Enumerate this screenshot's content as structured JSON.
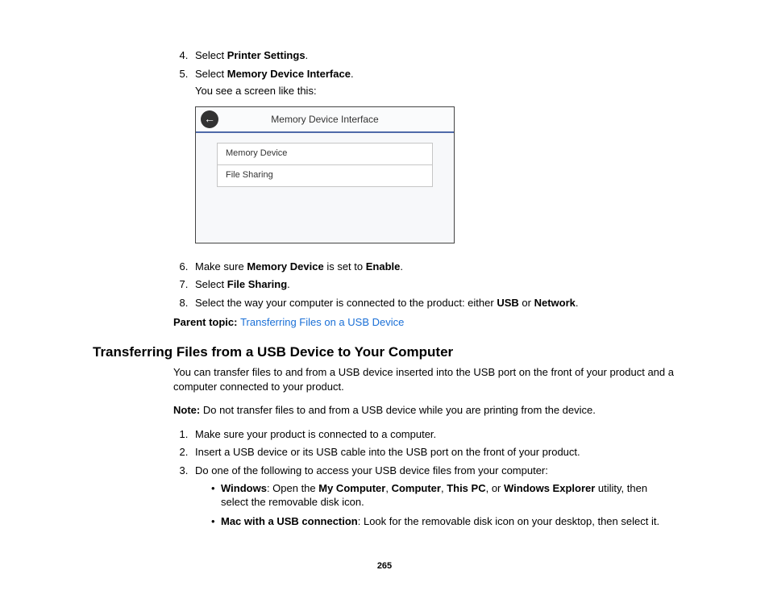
{
  "steps_top": {
    "4": {
      "pre": "Select ",
      "b": "Printer Settings",
      "post": "."
    },
    "5": {
      "pre": "Select ",
      "b": "Memory Device Interface",
      "post": ".",
      "after": "You see a screen like this:"
    },
    "6": {
      "pre": "Make sure ",
      "b": "Memory Device",
      "mid": " is set to ",
      "b2": "Enable",
      "post": "."
    },
    "7": {
      "pre": "Select ",
      "b": "File Sharing",
      "post": "."
    },
    "8": {
      "pre": "Select the way your computer is connected to the product: either ",
      "b": "USB",
      "mid": " or ",
      "b2": "Network",
      "post": "."
    }
  },
  "screenshot": {
    "back": "←",
    "title": "Memory Device Interface",
    "rows": [
      "Memory Device",
      "File Sharing"
    ]
  },
  "parent": {
    "label": "Parent topic: ",
    "link": "Transferring Files on a USB Device"
  },
  "section_title": "Transferring Files from a USB Device to Your Computer",
  "intro": "You can transfer files to and from a USB device inserted into the USB port on the front of your product and a computer connected to your product.",
  "note": {
    "label": "Note: ",
    "text": "Do not transfer files to and from a USB device while you are printing from the device."
  },
  "steps_bottom": {
    "1": "Make sure your product is connected to a computer.",
    "2": "Insert a USB device or its USB cable into the USB port on the front of your product.",
    "3": "Do one of the following to access your USB device files from your computer:"
  },
  "bullets": {
    "win": {
      "b1": "Windows",
      "t1": ": Open the ",
      "b2": "My Computer",
      "t2": ", ",
      "b3": "Computer",
      "t3": ", ",
      "b4": "This PC",
      "t4": ", or ",
      "b5": "Windows Explorer",
      "t5": " utility, then select the removable disk icon."
    },
    "mac": {
      "b1": "Mac with a USB connection",
      "t1": ": Look for the removable disk icon on your desktop, then select it."
    }
  },
  "pagenum": "265"
}
